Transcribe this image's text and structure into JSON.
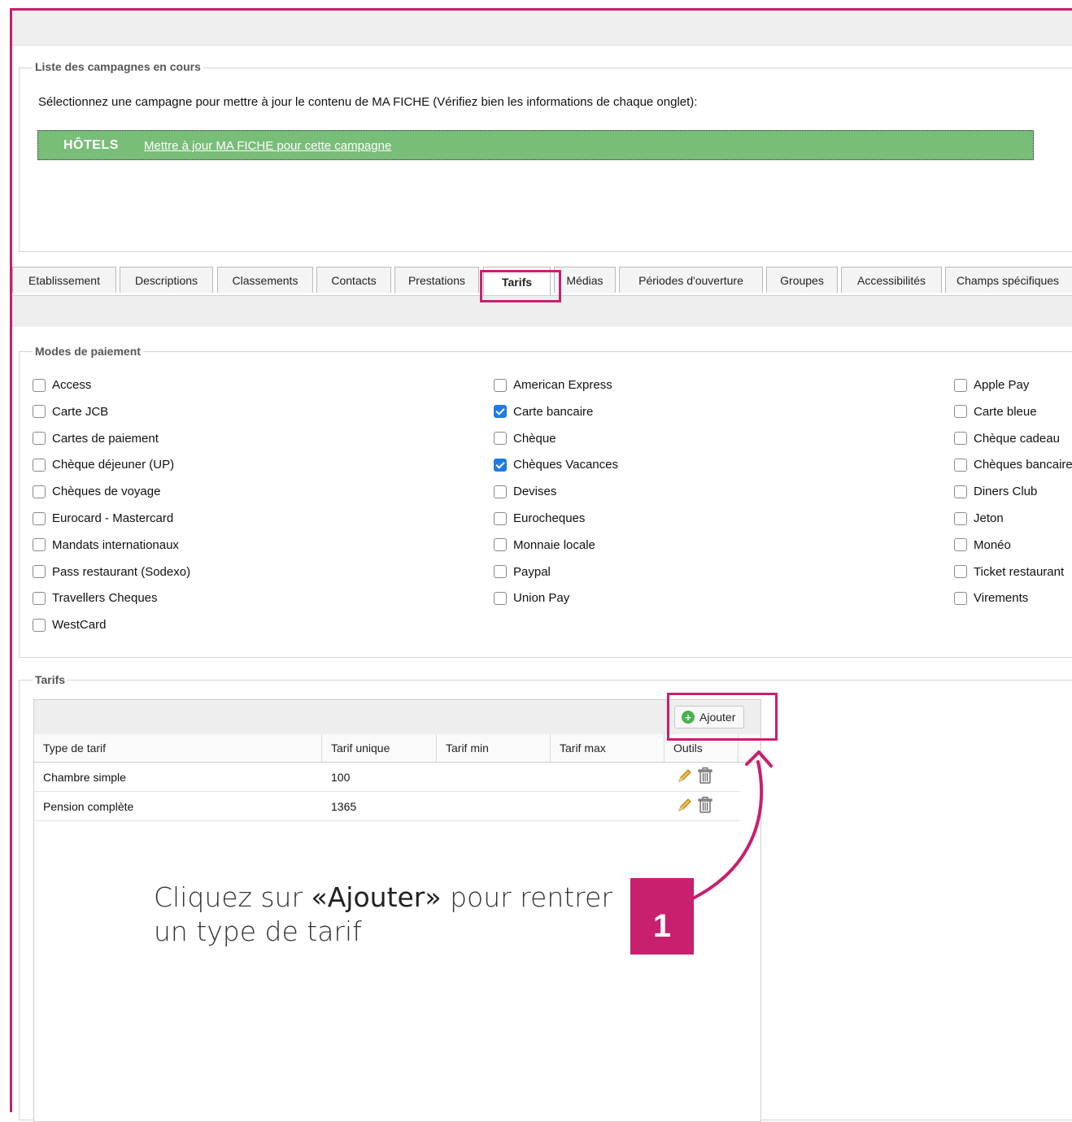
{
  "campaigns": {
    "legend": "Liste des campagnes en cours",
    "intro": "Sélectionnez une campagne pour mettre à jour le contenu de MA FICHE (Vérifiez bien les informations de chaque onglet):",
    "items": [
      {
        "name": "HÔTELS",
        "link_label": "Mettre à jour MA FICHE pour cette campagne"
      }
    ]
  },
  "tabs": {
    "active": "Tarifs",
    "items": [
      {
        "label": "Etablissement"
      },
      {
        "label": "Descriptions"
      },
      {
        "label": "Classements"
      },
      {
        "label": "Contacts"
      },
      {
        "label": "Prestations"
      },
      {
        "label": "Tarifs"
      },
      {
        "label": "Médias"
      },
      {
        "label": "Périodes d'ouverture"
      },
      {
        "label": "Groupes"
      },
      {
        "label": "Accessibilités"
      },
      {
        "label": "Champs spécifiques"
      }
    ]
  },
  "payment_modes": {
    "legend": "Modes de paiement",
    "columns": [
      [
        {
          "label": "Access",
          "checked": false
        },
        {
          "label": "Carte JCB",
          "checked": false
        },
        {
          "label": "Cartes de paiement",
          "checked": false
        },
        {
          "label": "Chèque déjeuner (UP)",
          "checked": false
        },
        {
          "label": "Chèques de voyage",
          "checked": false
        },
        {
          "label": "Eurocard - Mastercard",
          "checked": false
        },
        {
          "label": "Mandats internationaux",
          "checked": false
        },
        {
          "label": "Pass restaurant (Sodexo)",
          "checked": false
        },
        {
          "label": "Travellers Cheques",
          "checked": false
        },
        {
          "label": "WestCard",
          "checked": false
        }
      ],
      [
        {
          "label": "American Express",
          "checked": false
        },
        {
          "label": "Carte bancaire",
          "checked": true
        },
        {
          "label": "Chèque",
          "checked": false
        },
        {
          "label": "Chèques Vacances",
          "checked": true
        },
        {
          "label": "Devises",
          "checked": false
        },
        {
          "label": "Eurocheques",
          "checked": false
        },
        {
          "label": "Monnaie locale",
          "checked": false
        },
        {
          "label": "Paypal",
          "checked": false
        },
        {
          "label": "Union Pay",
          "checked": false
        }
      ],
      [
        {
          "label": "Apple Pay",
          "checked": false
        },
        {
          "label": "Carte bleue",
          "checked": false
        },
        {
          "label": "Chèque cadeau",
          "checked": false
        },
        {
          "label": "Chèques bancaires",
          "checked": false
        },
        {
          "label": "Diners Club",
          "checked": false
        },
        {
          "label": "Jeton",
          "checked": false
        },
        {
          "label": "Monéo",
          "checked": false
        },
        {
          "label": "Ticket restaurant",
          "checked": false
        },
        {
          "label": "Virements",
          "checked": false
        }
      ]
    ]
  },
  "tarifs": {
    "legend": "Tarifs",
    "add_label": "Ajouter",
    "columns": [
      "Type de tarif",
      "Tarif unique",
      "Tarif min",
      "Tarif max",
      "Outils"
    ],
    "rows": [
      {
        "type": "Chambre simple",
        "unique": "100",
        "min": "",
        "max": ""
      },
      {
        "type": "Pension complète",
        "unique": "1365",
        "min": "",
        "max": ""
      }
    ]
  },
  "callout": {
    "prefix": "Cliquez sur ",
    "bold": "«Ajouter»",
    "suffix": " pour rentrer",
    "line2": "un type de tarif",
    "step": "1"
  },
  "colors": {
    "accent": "#c81f6e",
    "campaign_row": "#78bd78",
    "checkbox_checked": "#1e7be3"
  }
}
